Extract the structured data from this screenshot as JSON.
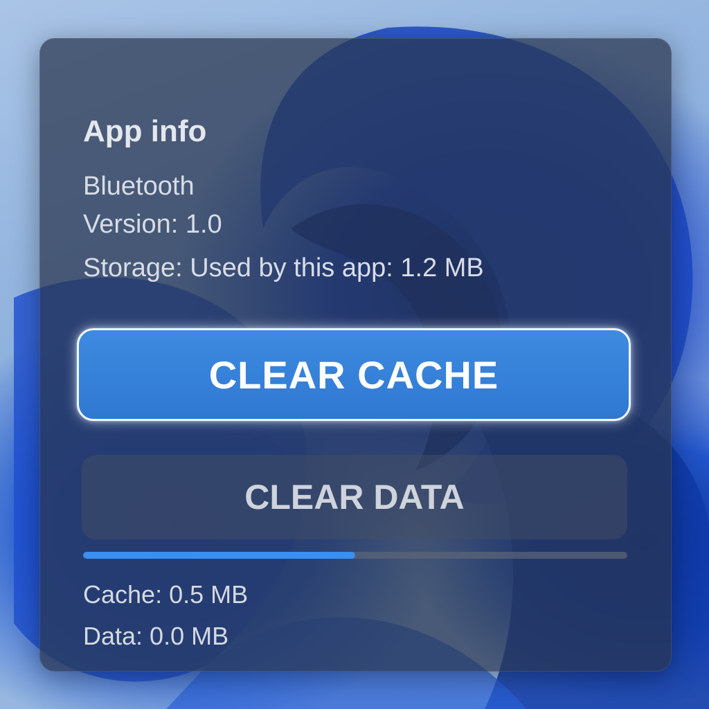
{
  "app_info": {
    "title": "App info",
    "app_name": "Bluetooth",
    "version": "Version: 1.0",
    "storage": "Storage: Used by this app: 1.2 MB"
  },
  "actions": {
    "clear_cache_label": "CLEAR CACHE",
    "clear_data_label": "CLEAR DATA"
  },
  "usage": {
    "progress_fraction": 0.5,
    "cache": "Cache: 0.5 MB",
    "data": "Data: 0.0 MB"
  },
  "colors": {
    "accent": "#2f78d2",
    "progress": "#3b8ff0",
    "panel": "#283450"
  }
}
